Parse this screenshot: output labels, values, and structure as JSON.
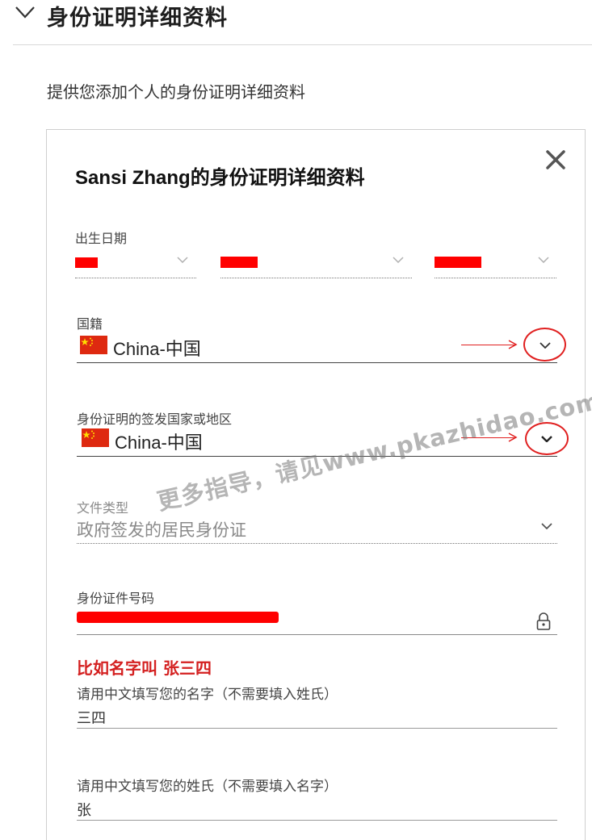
{
  "section": {
    "title": "身份证明详细资料",
    "intro": "提供您添加个人的身份证明详细资料"
  },
  "panel": {
    "title": "Sansi Zhang的身份证明详细资料",
    "close_icon": "close-icon",
    "dob": {
      "label": "出生日期",
      "fields": [
        "day",
        "month",
        "year"
      ]
    },
    "nationality": {
      "label": "国籍",
      "value": "China-中国",
      "flag_icon": "china-flag-icon"
    },
    "issuing_country": {
      "label": "身份证明的签发国家或地区",
      "value": "China-中国",
      "flag_icon": "china-flag-icon"
    },
    "document_type": {
      "label": "文件类型",
      "value": "政府签发的居民身份证"
    },
    "id_number": {
      "label": "身份证件号码",
      "lock_icon": "lock-icon"
    },
    "note": "比如名字叫 张三四",
    "given_name": {
      "label": "请用中文填写您的名字（不需要填入姓氏）",
      "value": "三四"
    },
    "surname": {
      "label": "请用中文填写您的姓氏（不需要填入名字）",
      "value": "张"
    }
  },
  "watermark": "更多指导，请见www.pkazhidao.com",
  "colors": {
    "annotation_red": "#e02020",
    "redaction": "#ff0000",
    "note_red": "#d42020"
  }
}
